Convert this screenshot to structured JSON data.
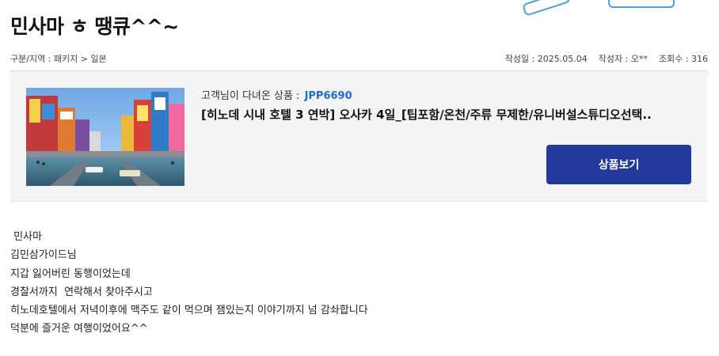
{
  "post": {
    "title": "민사마 ㅎ 땡큐^^~",
    "category": "구분/지역 : 패키지 > 일본",
    "date": "작성일 : 2025.05.04",
    "author": "작성자 : 오**",
    "views": "조회수 : 316"
  },
  "product": {
    "visited_label": "고객님이 다녀온 상품 :",
    "code": "JPP6690",
    "title": "[히노데 시내 호텔 3 연박] 오사카 4일_[팁포함/온천/주류 무제한/유니버설스튜디오선택..",
    "button_label": "상품보기"
  },
  "content": {
    "lines": [
      " 민사마",
      "김민삼가이드님",
      "지갑 잃어버린 동행이었는데",
      "경찰서까지  연락해서 찾아주시고",
      "히노데호텔에서 저녁이후에 맥주도 같이 먹으며 잼있는지 이야기까지 넘 감솨합니다",
      "덕분에 즐거운 여행이었어요^^"
    ]
  },
  "colors": {
    "button_bg": "#24399c",
    "code_color": "#1a6fd0",
    "panel_bg": "#f4f4f4"
  }
}
